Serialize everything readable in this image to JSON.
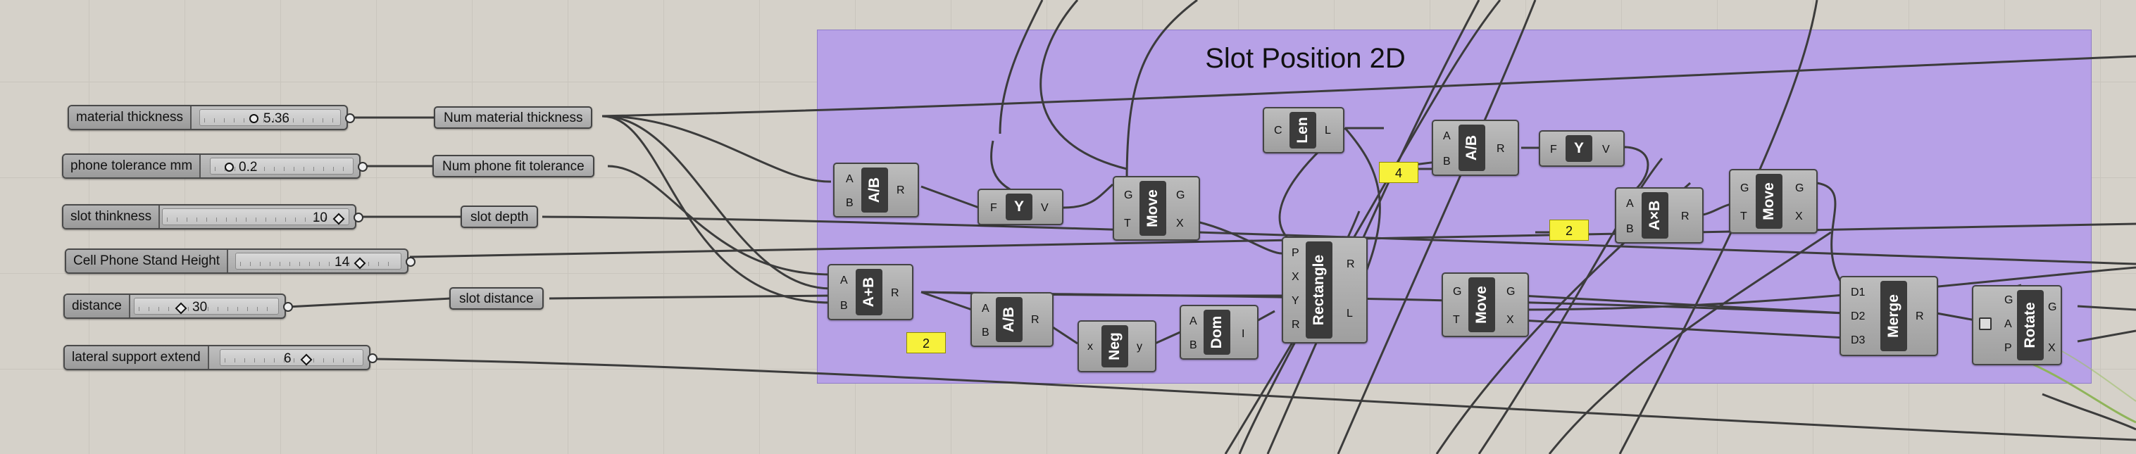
{
  "group": {
    "title": "Slot Position 2D",
    "color": "#b7a1e7"
  },
  "sliders": [
    {
      "id": "s1",
      "label": "material thickness",
      "value": "5.36"
    },
    {
      "id": "s2",
      "label": "phone tolerance mm",
      "value": "0.2"
    },
    {
      "id": "s3",
      "label": "slot thinkness",
      "value": "10"
    },
    {
      "id": "s4",
      "label": "Cell Phone Stand Height",
      "value": "14"
    },
    {
      "id": "s5",
      "label": "distance",
      "value": "30"
    },
    {
      "id": "s6",
      "label": "lateral support extend",
      "value": "6"
    }
  ],
  "params": [
    {
      "id": "p1",
      "label": "Num material thickness"
    },
    {
      "id": "p2",
      "label": "Num phone fit tolerance"
    },
    {
      "id": "p3",
      "label": "slot depth"
    },
    {
      "id": "p4",
      "label": "slot distance"
    }
  ],
  "components": [
    {
      "id": "c1",
      "name": "A/B",
      "inputs": [
        "A",
        "B"
      ],
      "outputs": [
        "R"
      ]
    },
    {
      "id": "c2",
      "name": "A+B",
      "inputs": [
        "A",
        "B"
      ],
      "outputs": [
        "R"
      ]
    },
    {
      "id": "c3",
      "name": "A/B",
      "inputs": [
        "A",
        "B"
      ],
      "outputs": [
        "R"
      ]
    },
    {
      "id": "c4",
      "name": "Y",
      "inputs": [
        "F"
      ],
      "outputs": [
        "V"
      ]
    },
    {
      "id": "c5",
      "name": "Move",
      "inputs": [
        "G",
        "T"
      ],
      "outputs": [
        "G",
        "X"
      ]
    },
    {
      "id": "c6",
      "name": "Neg",
      "inputs": [
        "x"
      ],
      "outputs": [
        "y"
      ]
    },
    {
      "id": "c7",
      "name": "Dom",
      "inputs": [
        "A",
        "B"
      ],
      "outputs": [
        "I"
      ]
    },
    {
      "id": "c8",
      "name": "Len",
      "inputs": [
        "C"
      ],
      "outputs": [
        "L"
      ]
    },
    {
      "id": "c9",
      "name": "Rectangle",
      "inputs": [
        "P",
        "X",
        "Y",
        "R"
      ],
      "outputs": [
        "R",
        "L"
      ]
    },
    {
      "id": "c10",
      "name": "A/B",
      "inputs": [
        "A",
        "B"
      ],
      "outputs": [
        "R"
      ]
    },
    {
      "id": "c11",
      "name": "Y",
      "inputs": [
        "F"
      ],
      "outputs": [
        "V"
      ]
    },
    {
      "id": "c12",
      "name": "Move",
      "inputs": [
        "G",
        "T"
      ],
      "outputs": [
        "G",
        "X"
      ]
    },
    {
      "id": "c13",
      "name": "A×B",
      "inputs": [
        "A",
        "B"
      ],
      "outputs": [
        "R"
      ]
    },
    {
      "id": "c14",
      "name": "Move",
      "inputs": [
        "G",
        "T"
      ],
      "outputs": [
        "G",
        "X"
      ]
    },
    {
      "id": "c15",
      "name": "Merge",
      "inputs": [
        "D1",
        "D2",
        "D3"
      ],
      "outputs": [
        "R"
      ]
    },
    {
      "id": "c16",
      "name": "Rotate",
      "inputs": [
        "G",
        "A",
        "P"
      ],
      "outputs": [
        "G",
        "X"
      ]
    }
  ],
  "panels": [
    {
      "id": "y1",
      "value": "2"
    },
    {
      "id": "y2",
      "value": "4"
    },
    {
      "id": "y3",
      "value": "2"
    }
  ]
}
